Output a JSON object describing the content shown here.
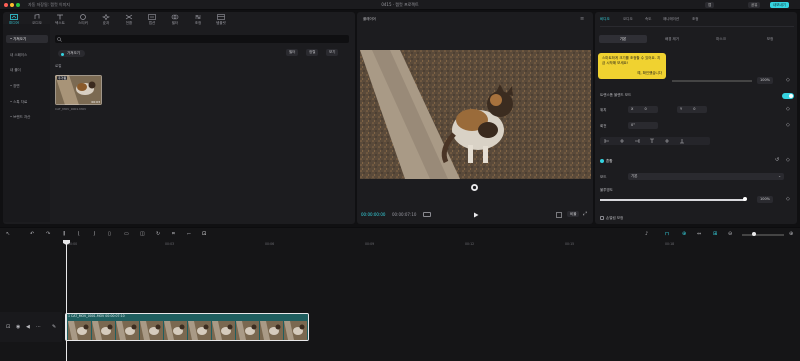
{
  "titlebar": {
    "left_text": "자동 저장됨: 캡컷 이미지",
    "title": "0415 · 캡컷 프로젝트",
    "profile_label": "캡",
    "share_label": "공유",
    "export_label": "내보내기"
  },
  "toolbar": [
    {
      "name": "media",
      "label": "미디어"
    },
    {
      "name": "audio",
      "label": "오디오"
    },
    {
      "name": "text",
      "label": "텍스트"
    },
    {
      "name": "stickers",
      "label": "스티커"
    },
    {
      "name": "effects",
      "label": "효과"
    },
    {
      "name": "transitions",
      "label": "전환"
    },
    {
      "name": "subtitles",
      "label": "캡션"
    },
    {
      "name": "filters",
      "label": "필터"
    },
    {
      "name": "adjust",
      "label": "조정"
    },
    {
      "name": "templates",
      "label": "템플릿"
    }
  ],
  "side_nav": [
    {
      "label": "• 가져오기",
      "active": true
    },
    {
      "label": "내 스페이스",
      "active": false
    },
    {
      "label": "내 폴더",
      "active": false
    },
    {
      "label": "• 장면",
      "active": false
    },
    {
      "label": "• 스톡 자료",
      "active": false
    },
    {
      "label": "• 브랜드 자산",
      "active": false
    }
  ],
  "media": {
    "import_label": "가져오기",
    "filter_buttons": [
      "필터",
      "정렬",
      "보기"
    ],
    "local_label": "로컬",
    "item_badge": "추가됨",
    "item_duration": "00:03",
    "item_name": "CAT_MOV_0001.MOV"
  },
  "player": {
    "title": "플레이어",
    "current_time": "00:00:00:00",
    "total_time": "00:00:07:10",
    "ratio_label": "비율"
  },
  "inspector": {
    "tabs": [
      "비디오",
      "오디오",
      "속도",
      "애니메이션",
      "조정"
    ],
    "subtabs": [
      "기본",
      "배경 제거",
      "마스크",
      "보정"
    ],
    "tooltip_text": "스마트하게 크기를 조정할 수 있어요. 지금 시작해 보세요!",
    "tooltip_button": "예, 확인했습니다",
    "opacity_value": "100%",
    "transform_label": "트랜스폼 블렌드 모드",
    "position_label": "위치",
    "x_label": "X",
    "x_value": "0",
    "y_label": "Y",
    "y_value": "0",
    "rotate_label": "회전",
    "rotate_value": "0°",
    "blend_section": "혼합",
    "mode_label": "모드",
    "mode_value": "기본",
    "opacity_label": "불투명도",
    "opacity2_value": "100%",
    "stabilize_label": "손떨림 보정",
    "opacity_level": 1.0
  },
  "timeline": {
    "ticks": [
      "00:00",
      "00:03",
      "00:06",
      "00:09",
      "00:12",
      "00:15",
      "00:18"
    ],
    "clip_label": "1 CAT_MOV_0001.MOV  00:00:07:10"
  },
  "colors": {
    "accent": "#35d3e0",
    "tooltip": "#f0d230",
    "clip": "#1f5e5f"
  }
}
